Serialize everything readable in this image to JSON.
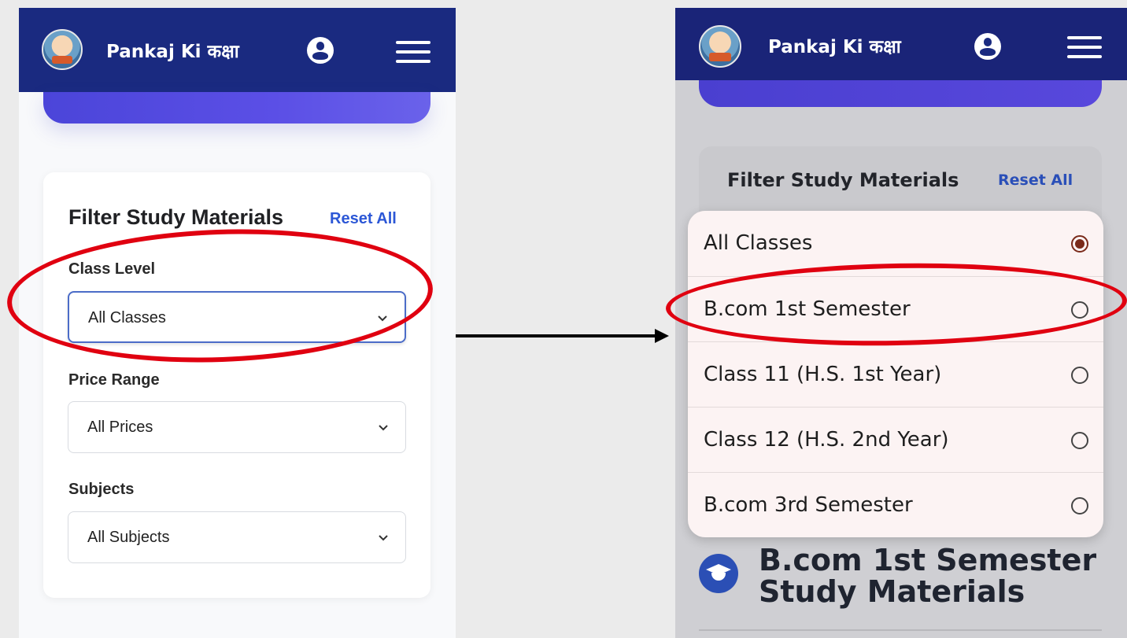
{
  "app": {
    "brand": "Pankaj Ki कक्षा",
    "accent": "#1a2a80"
  },
  "filter": {
    "title": "Filter Study Materials",
    "reset_label": "Reset All",
    "fields": [
      {
        "label": "Class Level",
        "value": "All Classes"
      },
      {
        "label": "Price Range",
        "value": "All Prices"
      },
      {
        "label": "Subjects",
        "value": "All Subjects"
      }
    ]
  },
  "right": {
    "title": "Filter Study Materials",
    "reset_label": "Reset All",
    "options": [
      {
        "label": "All Classes",
        "selected": true
      },
      {
        "label": "B.com 1st Semester",
        "selected": false
      },
      {
        "label": "Class 11 (H.S. 1st Year)",
        "selected": false
      },
      {
        "label": "Class 12 (H.S. 2nd Year)",
        "selected": false
      },
      {
        "label": "B.com 3rd Semester",
        "selected": false
      }
    ],
    "section_title_line1": "B.com 1st Semester",
    "section_title_line2": "Study Materials"
  },
  "icons": {
    "logo": "pankaj-logo-icon",
    "user": "user-circle-icon",
    "menu": "hamburger-menu-icon",
    "chevron": "chevron-down-icon",
    "graduation": "graduation-cap-icon"
  },
  "annotation_color": "#e00010"
}
